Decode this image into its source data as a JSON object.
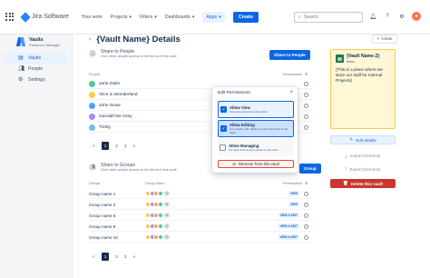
{
  "topnav": {
    "product": "Jira Software",
    "items": [
      "Your work",
      "Projects",
      "Filters",
      "Dashboards",
      "Apps"
    ],
    "create_label": "Create",
    "search_placeholder": "Search"
  },
  "sidebar": {
    "app_name": "Vaults",
    "app_subtitle": "Password Manager",
    "items": [
      {
        "label": "Vaults",
        "icon": "vault-icon"
      },
      {
        "label": "People",
        "icon": "people-icon"
      },
      {
        "label": "Settings",
        "icon": "gear-icon"
      }
    ]
  },
  "main": {
    "title": "{Vault Name} Details",
    "people": {
      "title": "Share to People",
      "subtitle": "Give other people access to the items in this vault",
      "share_label": "Share to People",
      "col_people": "People",
      "col_permissions": "Permissions",
      "rows": [
        "Jane Oatin",
        "Alice in Wonderland",
        "John Snow",
        "Gandalf the Grey",
        "Trinity"
      ],
      "pager": {
        "prev": "<",
        "current": "1",
        "pages": [
          "2",
          "3"
        ],
        "next": ">"
      }
    },
    "groups": {
      "title": "Share to Groups",
      "subtitle": "Give other people access to the items in this vault",
      "share_label": "Group",
      "col_groups": "Groups",
      "col_users": "Group Users",
      "col_permissions": "Permissions",
      "rows": [
        {
          "name": "Group name 1",
          "more": "+5",
          "perm": "VIEW"
        },
        {
          "name": "Group name 2",
          "more": "+4",
          "perm": "VIEW"
        },
        {
          "name": "Group name 5",
          "more": "+4",
          "perm": "VIEW & EDIT"
        },
        {
          "name": "Group name 8",
          "more": "+2",
          "perm": "VIEW & EDIT"
        },
        {
          "name": "Group name 10",
          "more": "+3",
          "perm": "VIEW & EDIT"
        }
      ],
      "pager": {
        "prev": "<",
        "current": "1",
        "pages": [
          "2",
          "3"
        ],
        "next": ">"
      }
    }
  },
  "popover": {
    "title": "Edit Permissions",
    "options": [
      {
        "title": "Allow View",
        "desc": "Can view elements in this vault"
      },
      {
        "title": "Allow Editing",
        "desc": "Can create, edit, delete & export elements in the vault"
      },
      {
        "title": "Allow Managing",
        "desc": "Can give and remove access to the vault"
      }
    ],
    "remove_label": "Remove from this vault"
  },
  "right": {
    "close_label": "Close",
    "card_title": "{Vault Name 2}",
    "card_sub": "Items",
    "card_text": "{This is a place where we store our stuff for Internal Projects}",
    "edit_label": "Edit details",
    "import_label": "Import Elements",
    "export_label": "Export Elements",
    "delete_label": "Delete this vault"
  },
  "colors": {
    "primary": "#0c66e4",
    "danger": "#c9372c",
    "card_bg": "#fff7d6"
  }
}
